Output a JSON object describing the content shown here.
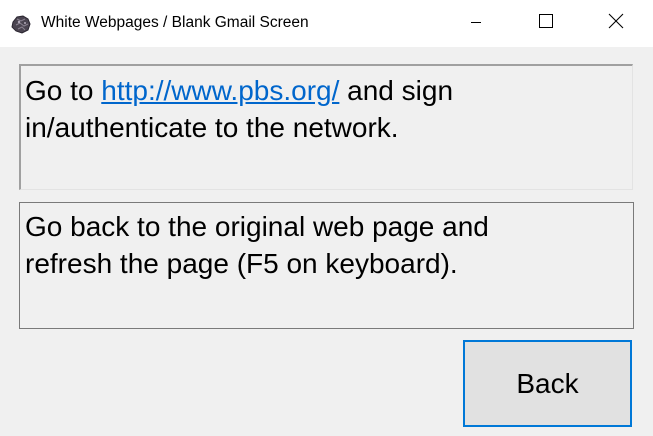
{
  "window": {
    "title": "White Webpages / Blank Gmail Screen",
    "app_icon": "rock-icon",
    "controls": {
      "minimize_icon": "minimize-icon",
      "maximize_icon": "maximize-icon",
      "close_icon": "close-icon"
    }
  },
  "step1": {
    "prefix": "Go to ",
    "link_text": "http://www.pbs.org/",
    "suffix_line1": " and sign",
    "line2": "in/authenticate to the network."
  },
  "step2": {
    "line1": "Go back to the original web page and",
    "line2": "refresh the page (F5 on keyboard)."
  },
  "actions": {
    "back_label": "Back"
  },
  "colors": {
    "link": "#0066cc",
    "button_focus_border": "#0078d7",
    "window_bg": "#f0f0f0",
    "titlebar_bg": "#ffffff"
  }
}
